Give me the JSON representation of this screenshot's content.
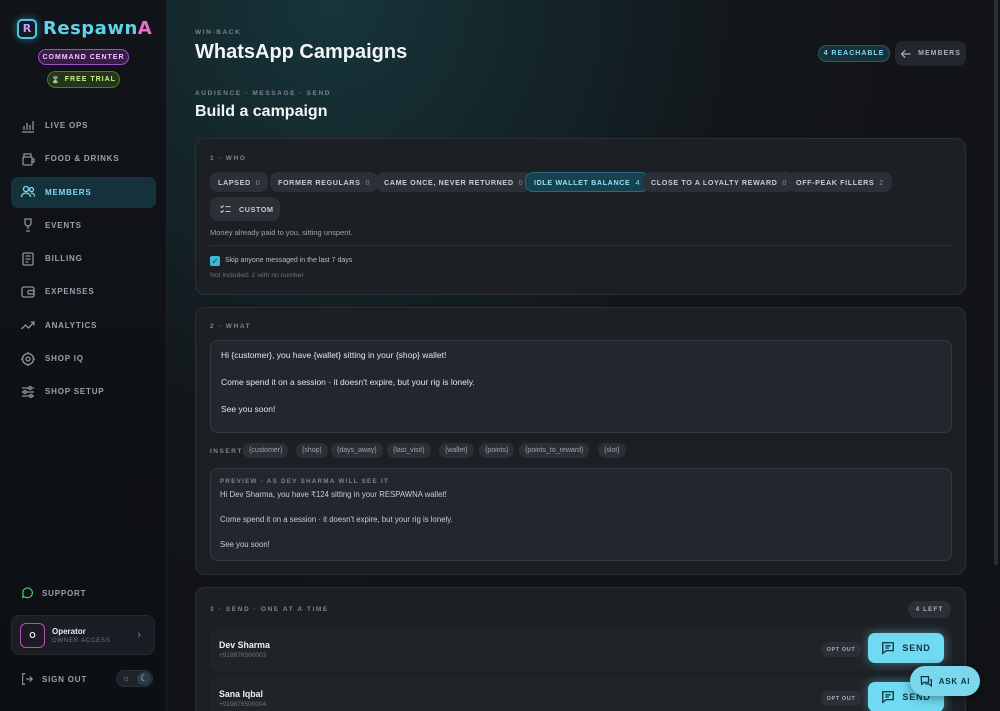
{
  "brand": {
    "mark": "R",
    "name_part1": "Respawn",
    "name_part2": "A",
    "command_center": "COMMAND CENTER",
    "free_trial": "FREE TRIAL"
  },
  "sidebar": {
    "items": [
      {
        "label": "LIVE OPS",
        "icon": "bar-chart-icon"
      },
      {
        "label": "FOOD & DRINKS",
        "icon": "cup-icon"
      },
      {
        "label": "MEMBERS",
        "icon": "users-icon",
        "active": true
      },
      {
        "label": "EVENTS",
        "icon": "trophy-icon"
      },
      {
        "label": "BILLING",
        "icon": "receipt-icon"
      },
      {
        "label": "EXPENSES",
        "icon": "wallet-icon"
      },
      {
        "label": "ANALYTICS",
        "icon": "trend-icon"
      },
      {
        "label": "SHOP IQ",
        "icon": "gear-brain-icon"
      },
      {
        "label": "SHOP SETUP",
        "icon": "sliders-icon"
      }
    ],
    "support": "SUPPORT",
    "operator": {
      "initial": "O",
      "name": "Operator",
      "role": "OWNER ACCESS"
    },
    "sign_out": "SIGN OUT"
  },
  "header": {
    "eyebrow": "WIN-BACK",
    "title": "WhatsApp Campaigns",
    "reachable": "4 REACHABLE",
    "members_button": "MEMBERS"
  },
  "builder": {
    "eyebrow": "AUDIENCE · MESSAGE · SEND",
    "title": "Build a campaign"
  },
  "who": {
    "label": "1 · WHO",
    "segments": [
      {
        "label": "LAPSED",
        "count": "0"
      },
      {
        "label": "FORMER REGULARS",
        "count": "0"
      },
      {
        "label": "CAME ONCE, NEVER RETURNED",
        "count": "0"
      },
      {
        "label": "IDLE WALLET BALANCE",
        "count": "4",
        "active": true
      },
      {
        "label": "CLOSE TO A LOYALTY REWARD",
        "count": "0"
      },
      {
        "label": "OFF-PEAK FILLERS",
        "count": "2"
      }
    ],
    "custom": "CUSTOM",
    "description": "Money already paid to you, sitting unspent.",
    "skip_label": "Skip anyone messaged in the last 7 days",
    "skip_checked": true,
    "not_included": "Not included: 2 with no number"
  },
  "what": {
    "label": "2 · WHAT",
    "message_lines": [
      "Hi {customer}, you have {wallet} sitting in your {shop} wallet!",
      "",
      "Come spend it on a session · it doesn't expire, but your rig is lonely.",
      "",
      "See you soon!"
    ],
    "insert_label": "INSERT",
    "tokens": [
      "{customer}",
      "{shop}",
      "{days_away}",
      "{last_visit}",
      "{wallet}",
      "{points}",
      "{points_to_reward}",
      "{slot}"
    ],
    "preview_label": "PREVIEW · AS DEV SHARMA WILL SEE IT",
    "preview_lines": [
      "Hi Dev Sharma, you have ₹124 sitting in your RESPAWNA wallet!",
      "",
      "Come spend it on a session · it doesn't expire, but your rig is lonely.",
      "",
      "See you soon!"
    ]
  },
  "send": {
    "label": "3 · SEND · ONE AT A TIME",
    "left": "4 LEFT",
    "recipients": [
      {
        "name": "Dev Sharma",
        "phone": "+919876500003",
        "opt_out": "OPT OUT",
        "send": "SEND"
      },
      {
        "name": "Sana Iqbal",
        "phone": "+919876500004",
        "opt_out": "OPT OUT",
        "send": "SEND"
      }
    ]
  },
  "ask_ai": "ASK AI",
  "colors": {
    "accent": "#6fdaf1",
    "brand_pink": "#e86fc8",
    "active_nav": "#15323c"
  }
}
